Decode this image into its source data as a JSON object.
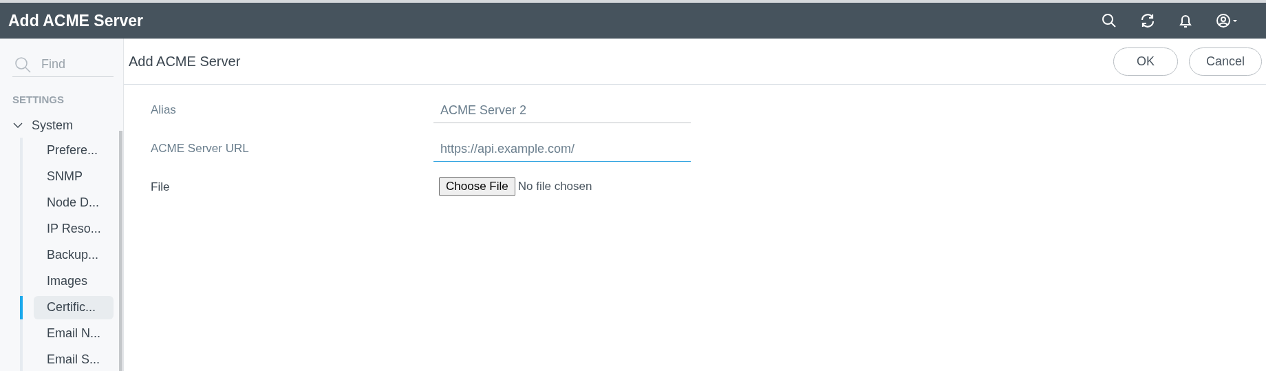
{
  "header": {
    "title": "Add ACME Server"
  },
  "sidebar": {
    "search": {
      "placeholder": "Find"
    },
    "section": "SETTINGS",
    "group": {
      "label": "System",
      "expanded": true,
      "children": [
        {
          "label": "Prefere...",
          "selected": false
        },
        {
          "label": "SNMP",
          "selected": false
        },
        {
          "label": "Node D...",
          "selected": false
        },
        {
          "label": "IP Reso...",
          "selected": false
        },
        {
          "label": "Backup...",
          "selected": false
        },
        {
          "label": "Images",
          "selected": false
        },
        {
          "label": "Certific...",
          "selected": true
        },
        {
          "label": "Email N...",
          "selected": false
        },
        {
          "label": "Email S...",
          "selected": false
        }
      ]
    }
  },
  "page": {
    "title": "Add ACME Server",
    "buttons": [
      "OK",
      "Cancel"
    ],
    "fields": [
      {
        "kind": "text",
        "label": "Alias",
        "value": "ACME Server 2",
        "focused": false
      },
      {
        "kind": "text",
        "label": "ACME Server URL",
        "value": "https://api.example.com/",
        "focused": true
      },
      {
        "kind": "file",
        "label": "File",
        "button": "Choose File",
        "status": "No file chosen"
      }
    ]
  }
}
